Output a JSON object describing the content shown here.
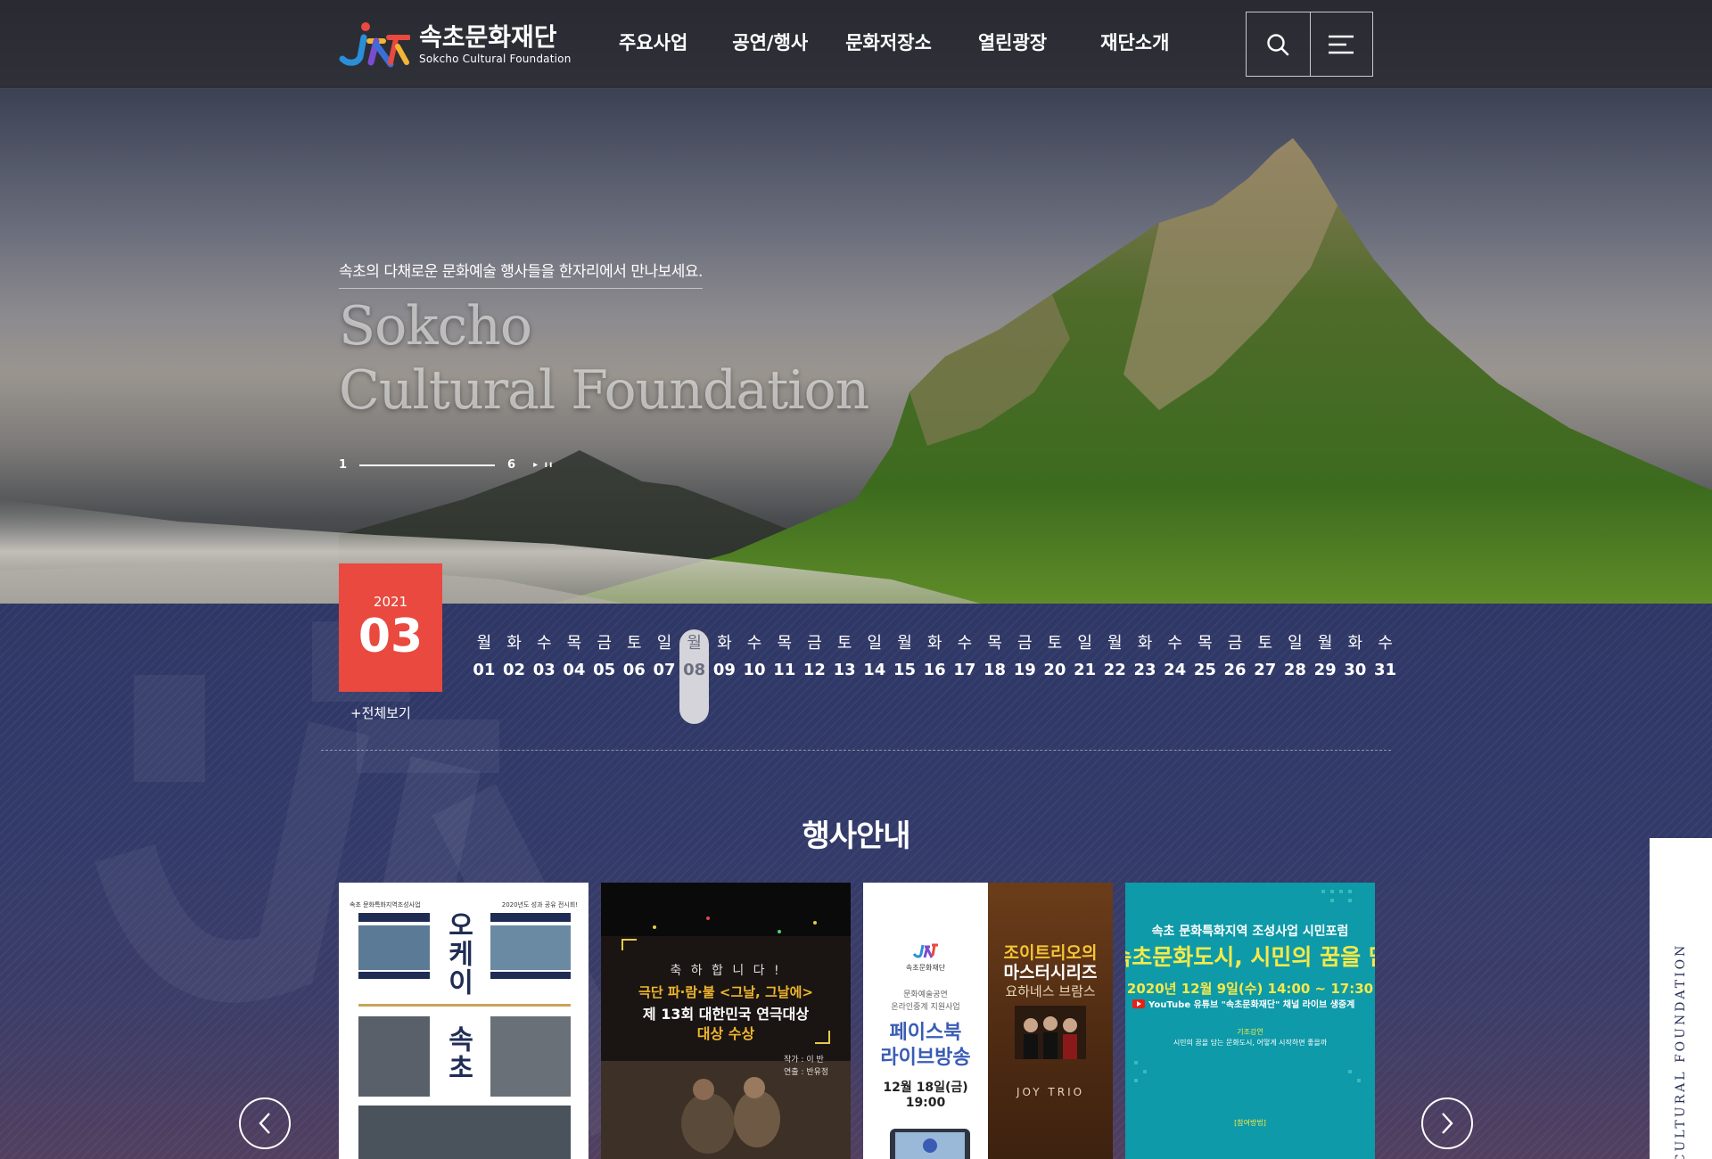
{
  "brand": {
    "name_ko": "속초문화재단",
    "name_en": "Sokcho Cultural Foundation"
  },
  "nav": {
    "items": [
      {
        "label": "주요사업"
      },
      {
        "label": "공연/행사"
      },
      {
        "label": "문화저장소"
      },
      {
        "label": "열린광장"
      },
      {
        "label": "재단소개"
      }
    ],
    "search_icon": "search-icon",
    "menu_icon": "hamburger-menu-icon"
  },
  "hero": {
    "subtitle": "속초의 다채로운 문화예술 행사들을 한자리에서 만나보세요.",
    "title_line1": "Sokcho",
    "title_line2": "Cultural Foundation",
    "slide_current": "1",
    "slide_total": "6",
    "slide_controls": "▸ ıı"
  },
  "calendar": {
    "year": "2021",
    "month": "03",
    "view_all": "+전체보기",
    "selected_day": "08",
    "days": [
      {
        "dow": "월",
        "num": "01"
      },
      {
        "dow": "화",
        "num": "02"
      },
      {
        "dow": "수",
        "num": "03"
      },
      {
        "dow": "목",
        "num": "04"
      },
      {
        "dow": "금",
        "num": "05"
      },
      {
        "dow": "토",
        "num": "06"
      },
      {
        "dow": "일",
        "num": "07"
      },
      {
        "dow": "월",
        "num": "08"
      },
      {
        "dow": "화",
        "num": "09"
      },
      {
        "dow": "수",
        "num": "10"
      },
      {
        "dow": "목",
        "num": "11"
      },
      {
        "dow": "금",
        "num": "12"
      },
      {
        "dow": "토",
        "num": "13"
      },
      {
        "dow": "일",
        "num": "14"
      },
      {
        "dow": "월",
        "num": "15"
      },
      {
        "dow": "화",
        "num": "16"
      },
      {
        "dow": "수",
        "num": "17"
      },
      {
        "dow": "목",
        "num": "18"
      },
      {
        "dow": "금",
        "num": "19"
      },
      {
        "dow": "토",
        "num": "20"
      },
      {
        "dow": "일",
        "num": "21"
      },
      {
        "dow": "월",
        "num": "22"
      },
      {
        "dow": "화",
        "num": "23"
      },
      {
        "dow": "수",
        "num": "24"
      },
      {
        "dow": "목",
        "num": "25"
      },
      {
        "dow": "금",
        "num": "26"
      },
      {
        "dow": "토",
        "num": "27"
      },
      {
        "dow": "일",
        "num": "28"
      },
      {
        "dow": "월",
        "num": "29"
      },
      {
        "dow": "화",
        "num": "30"
      },
      {
        "dow": "수",
        "num": "31"
      }
    ]
  },
  "events": {
    "title": "행사안내",
    "side_tab": "HO CULTURAL FOUNDATION",
    "cards": [
      {
        "left_top": "속초 문화특화지역조성사업",
        "right_top": "2020년도 성과 공유 전시회!",
        "heading": "오케이",
        "heading2": "속초"
      },
      {
        "line1": "축 하 합 니 다 !",
        "line2": "극단 파·람·불 <그날, 그날에>",
        "line3": "제 13회 대한민국 연극대상",
        "line4": "대상 수상",
        "credit1": "작가 : 이  반",
        "credit2": "연출 : 반유정"
      },
      {
        "org": "속초문화재단",
        "sub1": "문화예술공연",
        "sub2": "온라인중계 지원사업",
        "fb1": "페이스북",
        "fb2": "라이브방송",
        "date": "12월 18일(금) 19:00",
        "r1": "조이트리오의",
        "r2": "마스터시리즈",
        "r3": "요하네스 브람스",
        "joy": "JOY TRIO"
      },
      {
        "line1": "속초 문화특화지역 조성사업 시민포럼",
        "line2": "속초문화도시, 시민의 꿈을 담",
        "line3": "2020년 12월 9일(수) 14:00 ~ 17:30",
        "line4": "YouTube 유튜브 \"속초문화재단\" 채널 라이브 생중계",
        "line5": "기조강연",
        "line6": "시민의 꿈을 담는 문화도시, 어떻게 시작하면 좋을까",
        "line7": "[참여방법]"
      }
    ]
  },
  "colors": {
    "accent_red": "#e9493f",
    "header_bg": "#2c2c30",
    "calendar_bg": "#2f3766",
    "selected_day_bg": "#d4d4da",
    "card4_bg": "#0e9aa8"
  }
}
